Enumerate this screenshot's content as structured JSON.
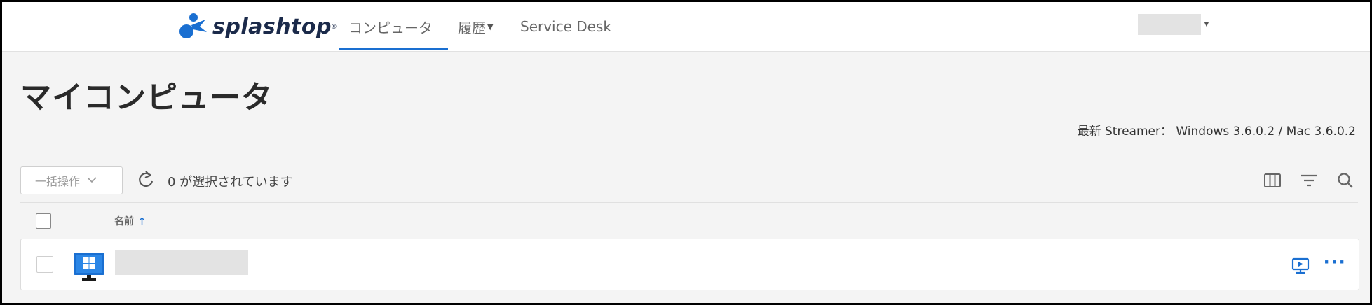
{
  "header": {
    "logo_text": "splashtop",
    "tabs": [
      {
        "label": "コンピュータ",
        "active": true
      },
      {
        "label": "履歴",
        "has_dropdown": true
      },
      {
        "label": "Service Desk"
      }
    ],
    "user_menu": {
      "redacted": true
    }
  },
  "page": {
    "title": "マイコンピュータ",
    "streamer_label": "最新 Streamer：",
    "streamer_versions": "Windows 3.6.0.2 / Mac 3.6.0.2"
  },
  "toolbar": {
    "bulk_action_label": "一括操作",
    "selected_count_text": "0 が選択されています",
    "icons": [
      "refresh-icon",
      "columns-icon",
      "filter-icon",
      "search-icon"
    ]
  },
  "table": {
    "columns": [
      {
        "label": "名前",
        "sort": "ascending"
      }
    ],
    "rows": [
      {
        "os": "windows",
        "name_redacted": true
      }
    ]
  },
  "colors": {
    "accent": "#1a6fd1",
    "background": "#f4f4f4",
    "logo_dark": "#1b2a4a"
  }
}
